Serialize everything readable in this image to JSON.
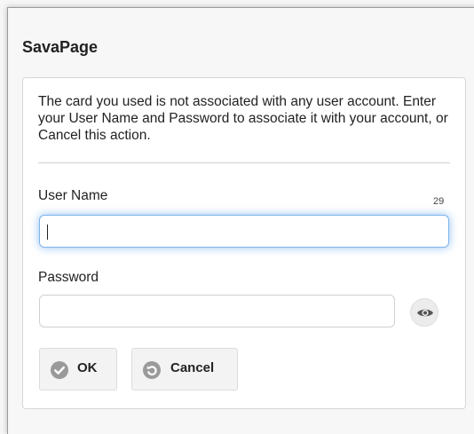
{
  "dialog": {
    "title": "SavaPage",
    "message": "The card you used is not associated with any user account. Enter your User Name and Password to associate it with your account, or Cancel this action."
  },
  "form": {
    "username_label": "User Name",
    "username_counter": "29",
    "username_value": "",
    "password_label": "Password",
    "password_value": ""
  },
  "buttons": {
    "ok_label": "OK",
    "cancel_label": "Cancel"
  },
  "icons": {
    "show_password": "eye-icon",
    "ok": "check-circle-icon",
    "cancel": "undo-circle-icon"
  },
  "colors": {
    "focus_glow": "#388ceb",
    "icon_gray": "#9a9a9a"
  }
}
